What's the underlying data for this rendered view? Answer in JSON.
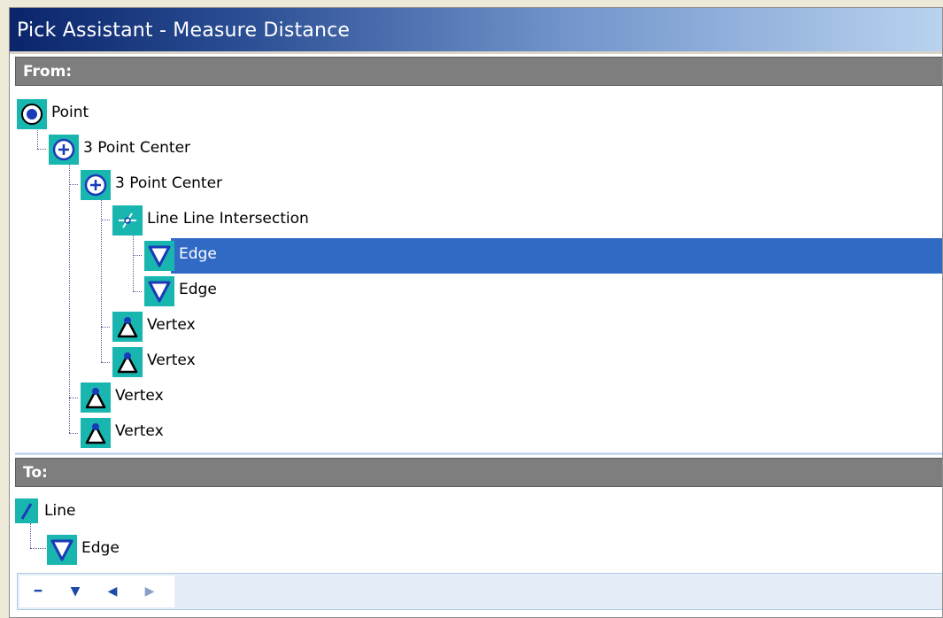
{
  "window": {
    "title": "Pick Assistant - Measure Distance"
  },
  "from_section": {
    "header": "From:",
    "tree": [
      {
        "label": "Point",
        "icon": "point-radio-icon"
      },
      {
        "label": "3 Point Center",
        "icon": "three-point-center-icon"
      },
      {
        "label": "3 Point Center",
        "icon": "three-point-center-icon"
      },
      {
        "label": "Line Line Intersection",
        "icon": "line-intersection-icon"
      },
      {
        "label": "Edge",
        "icon": "edge-icon",
        "selected": true
      },
      {
        "label": "Edge",
        "icon": "edge-icon"
      },
      {
        "label": "Vertex",
        "icon": "vertex-icon"
      },
      {
        "label": "Vertex",
        "icon": "vertex-icon"
      },
      {
        "label": "Vertex",
        "icon": "vertex-icon"
      },
      {
        "label": "Vertex",
        "icon": "vertex-icon"
      }
    ]
  },
  "to_section": {
    "header": "To:",
    "tree": [
      {
        "label": "Line",
        "icon": "line-icon"
      },
      {
        "label": "Edge",
        "icon": "edge-icon"
      }
    ]
  },
  "nav_toolbar": {
    "buttons": [
      {
        "icon": "minus-icon",
        "glyph": "━"
      },
      {
        "icon": "chevron-down-icon",
        "glyph": "▼"
      },
      {
        "icon": "chevron-left-icon",
        "glyph": "◀"
      },
      {
        "icon": "chevron-right-icon",
        "glyph": "▶"
      }
    ]
  },
  "colors": {
    "selection": "#316ac5",
    "icon_bg": "#19b6b0",
    "header_bg": "#7e7e7e",
    "title_dark": "#0a246a"
  }
}
